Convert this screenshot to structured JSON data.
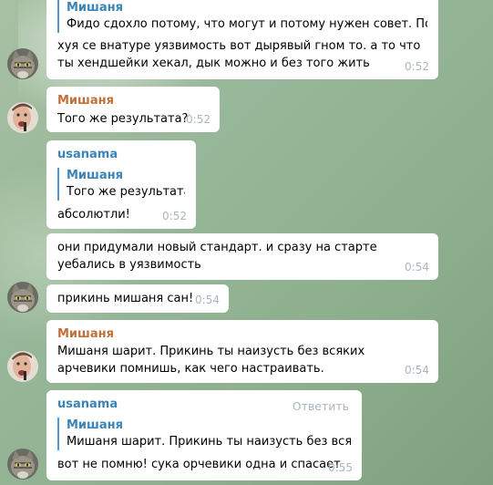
{
  "messages": [
    {
      "reply_author": "Мишаня",
      "reply_text": "Фидо сдохло потому, что могут и потому нужен совет. Помн...",
      "text": "хуя се внатуре уязвимость вот дырявый гном то. а то что ты хендшейки хекал, дык можно и без того жить",
      "time": "0:52"
    },
    {
      "author": "Мишаня",
      "text": "Того же результата?",
      "time": "0:52"
    },
    {
      "author": "usanama",
      "reply_author": "Мишаня",
      "reply_text": "Того же результата?",
      "text": "абсолютли!",
      "time": "0:52"
    },
    {
      "text": "они придумали новый стандарт. и сразу на старте уебались в уязвимость",
      "time": "0:54"
    },
    {
      "text": "прикинь мишаня сан!",
      "time": "0:54"
    },
    {
      "author": "Мишаня",
      "text": "Мишаня шарит. Прикинь ты наизусть без всяких арчевики помнишь, как чего настраивать.",
      "time": "0:54"
    },
    {
      "author": "usanama",
      "action": "Ответить",
      "reply_author": "Мишаня",
      "reply_text": "Мишаня шарит. Прикинь ты наизусть без всяк...",
      "text": "вот не помню! сука орчевики одна и спасает",
      "time": "0:55"
    }
  ],
  "avatars": {
    "cat": "cat-avatar",
    "man": "man-avatar"
  }
}
